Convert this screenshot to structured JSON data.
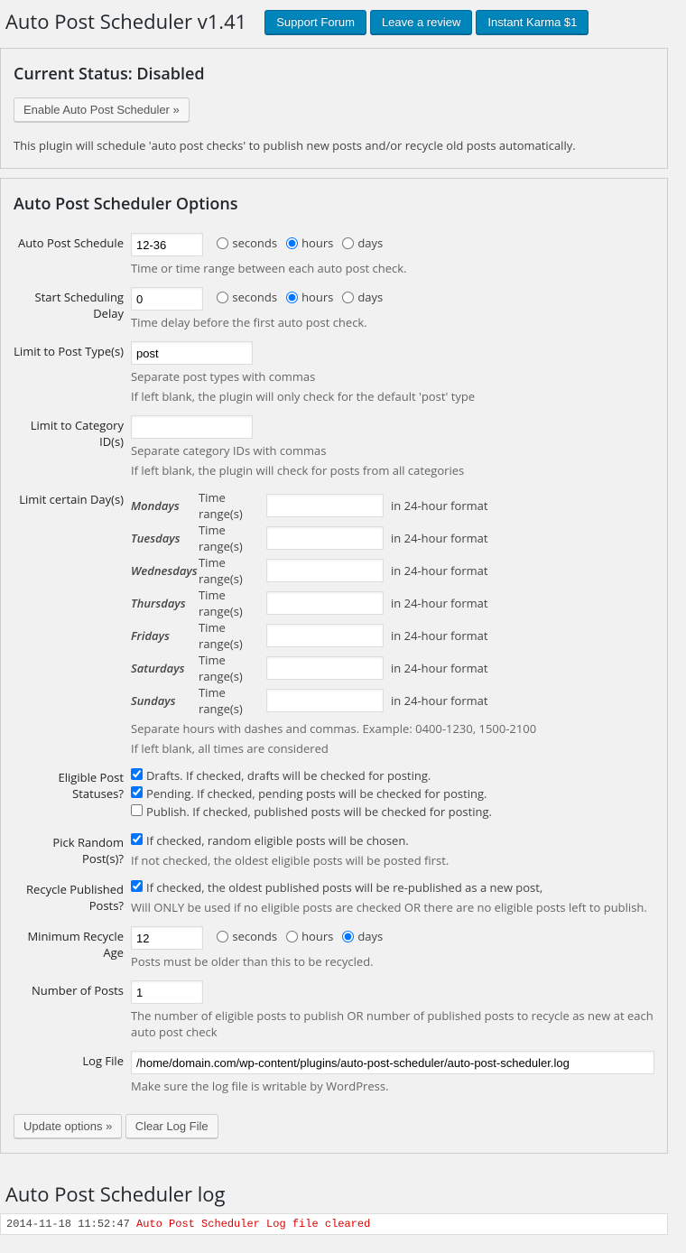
{
  "header": {
    "title": "Auto Post Scheduler v1.41",
    "btn_support": "Support Forum",
    "btn_review": "Leave a review",
    "btn_karma": "Instant Karma $1"
  },
  "status": {
    "heading": "Current Status: Disabled",
    "enable_btn": "Enable Auto Post Scheduler »",
    "desc": "This plugin will schedule 'auto post checks' to publish new posts and/or recycle old posts automatically."
  },
  "options": {
    "heading": "Auto Post Scheduler Options",
    "schedule": {
      "label": "Auto Post Schedule",
      "value": "12-36",
      "unit_seconds": "seconds",
      "unit_hours": "hours",
      "unit_days": "days",
      "desc": "Time or time range between each auto post check."
    },
    "delay": {
      "label": "Start Scheduling Delay",
      "value": "0",
      "desc": "Time delay before the first auto post check."
    },
    "post_types": {
      "label": "Limit to Post Type(s)",
      "value": "post",
      "desc1": "Separate post types with commas",
      "desc2": "If left blank, the plugin will only check for the default 'post' type"
    },
    "categories": {
      "label": "Limit to Category ID(s)",
      "value": "",
      "desc1": "Separate category IDs with commas",
      "desc2": "If left blank, the plugin will check for posts from all categories"
    },
    "days": {
      "label": "Limit certain Day(s)",
      "time_ranges_label": "Time range(s)",
      "suffix": "in 24-hour format",
      "names": [
        "Mondays",
        "Tuesdays",
        "Wednesdays",
        "Thursdays",
        "Fridays",
        "Saturdays",
        "Sundays"
      ],
      "values": [
        "",
        "",
        "",
        "",
        "",
        "",
        ""
      ],
      "desc1": "Separate hours with dashes and commas. Example: 0400-1230, 1500-2100",
      "desc2": "If left blank, all times are considered"
    },
    "eligible": {
      "label": "Eligible Post Statuses?",
      "drafts": "Drafts. If checked, drafts will be checked for posting.",
      "pending": "Pending. If checked, pending posts will be checked for posting.",
      "publish": "Publish. If checked, published posts will be checked for posting."
    },
    "random": {
      "label": "Pick Random Post(s)?",
      "text": "If checked, random eligible posts will be chosen.",
      "desc": "If not checked, the oldest eligible posts will be posted first."
    },
    "recycle": {
      "label": "Recycle Published Posts?",
      "text": "If checked, the oldest published posts will be re-published as a new post,",
      "desc": "Will ONLY be used if no eligible posts are checked OR there are no eligible posts left to publish."
    },
    "min_age": {
      "label": "Minimum Recycle Age",
      "value": "12",
      "desc": "Posts must be older than this to be recycled."
    },
    "num_posts": {
      "label": "Number of Posts",
      "value": "1",
      "desc": "The number of eligible posts to publish OR number of published posts to recycle as new at each auto post check"
    },
    "logfile": {
      "label": "Log File",
      "value": "/home/domain.com/wp-content/plugins/auto-post-scheduler/auto-post-scheduler.log",
      "desc": "Make sure the log file is writable by WordPress."
    },
    "btn_update": "Update options »",
    "btn_clear": "Clear Log File"
  },
  "log": {
    "heading": "Auto Post Scheduler log",
    "timestamp": "2014-11-18 11:52:47",
    "message": "Auto Post Scheduler Log file cleared"
  }
}
